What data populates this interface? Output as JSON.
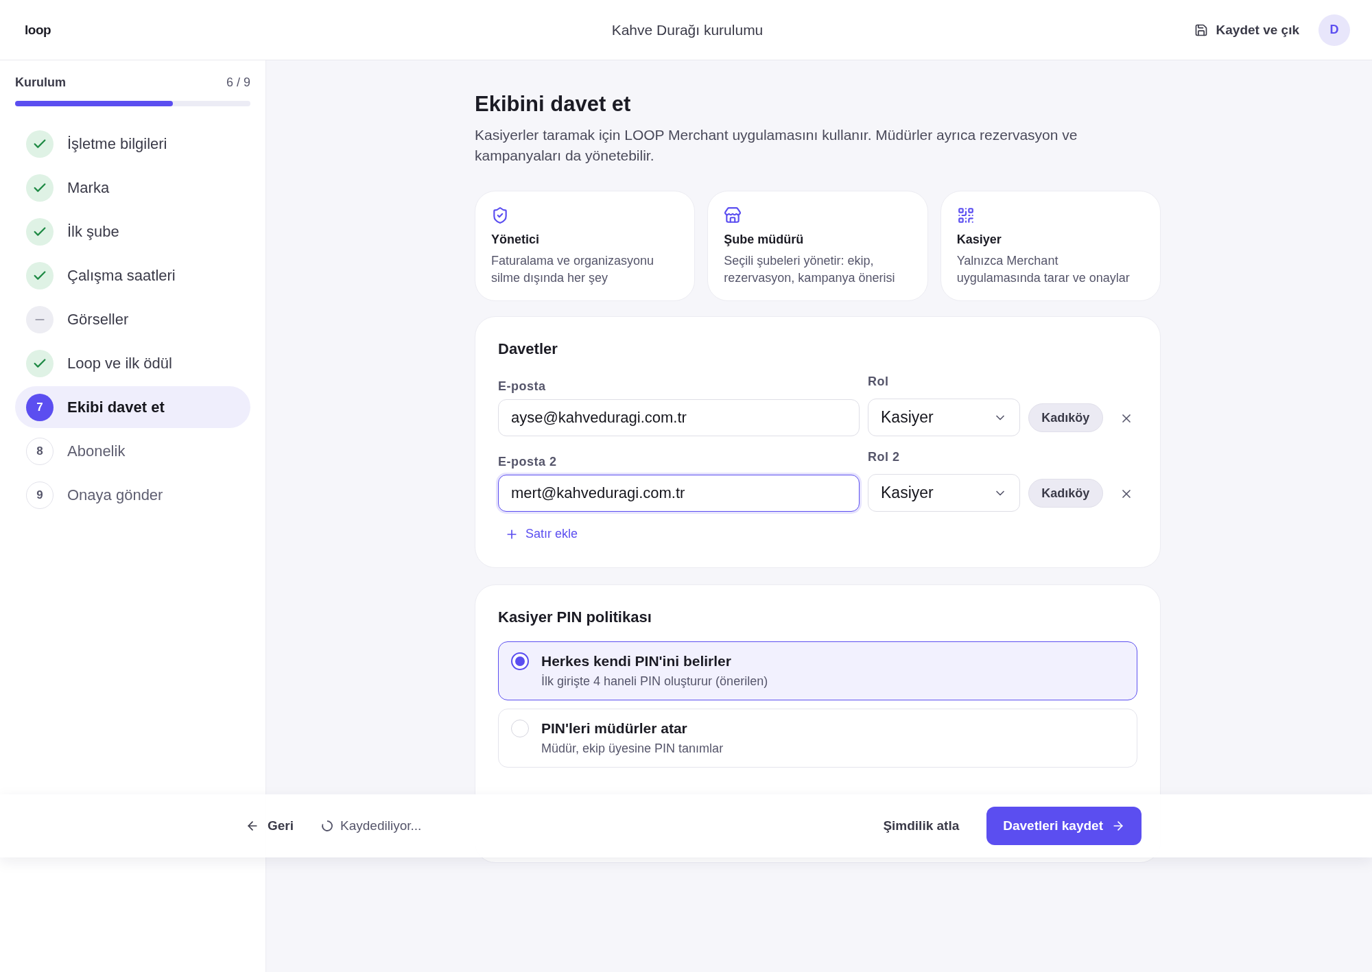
{
  "header": {
    "logo": "loop",
    "title": "Kahve Durağı kurulumu",
    "save_exit": "Kaydet ve çık",
    "avatar": "D"
  },
  "sidebar": {
    "title": "Kurulum",
    "count": "6 / 9",
    "level": 0.67,
    "steps": [
      {
        "label": "İşletme bilgileri",
        "kind": "done",
        "selected": false
      },
      {
        "label": "Marka",
        "kind": "done",
        "selected": false
      },
      {
        "label": "İlk şube",
        "kind": "done",
        "selected": false
      },
      {
        "label": "Çalışma saatleri",
        "kind": "done",
        "selected": false
      },
      {
        "label": "Görseller",
        "kind": "skipped",
        "selected": false
      },
      {
        "label": "Loop ve ilk ödül",
        "kind": "done",
        "selected": false
      },
      {
        "label": "Ekibi davet et",
        "kind": "numbered",
        "number": "7",
        "selected": true
      },
      {
        "label": "Abonelik",
        "kind": "numbered",
        "number": "8",
        "selected": false
      },
      {
        "label": "Onaya gönder",
        "kind": "numbered",
        "number": "9",
        "selected": false
      }
    ]
  },
  "page": {
    "title": "Ekibini davet et",
    "subtitle": "Kasiyerler taramak için LOOP Merchant uygulamasını kullanır. Müdürler ayrıca rezervasyon ve kampanyaları da yönetebilir."
  },
  "roles": [
    {
      "kind": "shield",
      "title": "Yönetici",
      "description": "Faturalama ve organizasyonu silme dışında her şey"
    },
    {
      "kind": "store",
      "title": "Şube müdürü",
      "description": "Seçili şubeleri yönetir: ekip, rezervasyon, kampanya önerisi"
    },
    {
      "kind": "qr",
      "title": "Kasiyer",
      "description": "Yalnızca Merchant uygulamasında tarar ve onaylar"
    }
  ],
  "invites": {
    "title": "Davetler",
    "rows": [
      {
        "email_label": "E-posta",
        "email": "ayse@kahveduragi.com.tr",
        "focused": false,
        "role_label": "Rol",
        "role": "Kasiyer",
        "branch": "Kadıköy"
      },
      {
        "email_label": "E-posta 2",
        "email": "mert@kahveduragi.com.tr",
        "focused": true,
        "role_label": "Rol 2",
        "role": "Kasiyer",
        "branch": "Kadıköy"
      }
    ],
    "add_row": "Satır ekle"
  },
  "pin_policy": {
    "title": "Kasiyer PIN politikası",
    "options": [
      {
        "title": "Herkes kendi PIN'ini belirler",
        "description": "İlk girişte 4 haneli PIN oluşturur (önerilen)",
        "selected": true
      },
      {
        "title": "PIN'leri müdürler atar",
        "description": "Müdür, ekip üyesine PIN tanımlar",
        "selected": false
      }
    ]
  },
  "footer": {
    "back": "Geri",
    "saving": "Kaydediliyor...",
    "skip": "Şimdilik atla",
    "primary": "Davetleri kaydet"
  }
}
